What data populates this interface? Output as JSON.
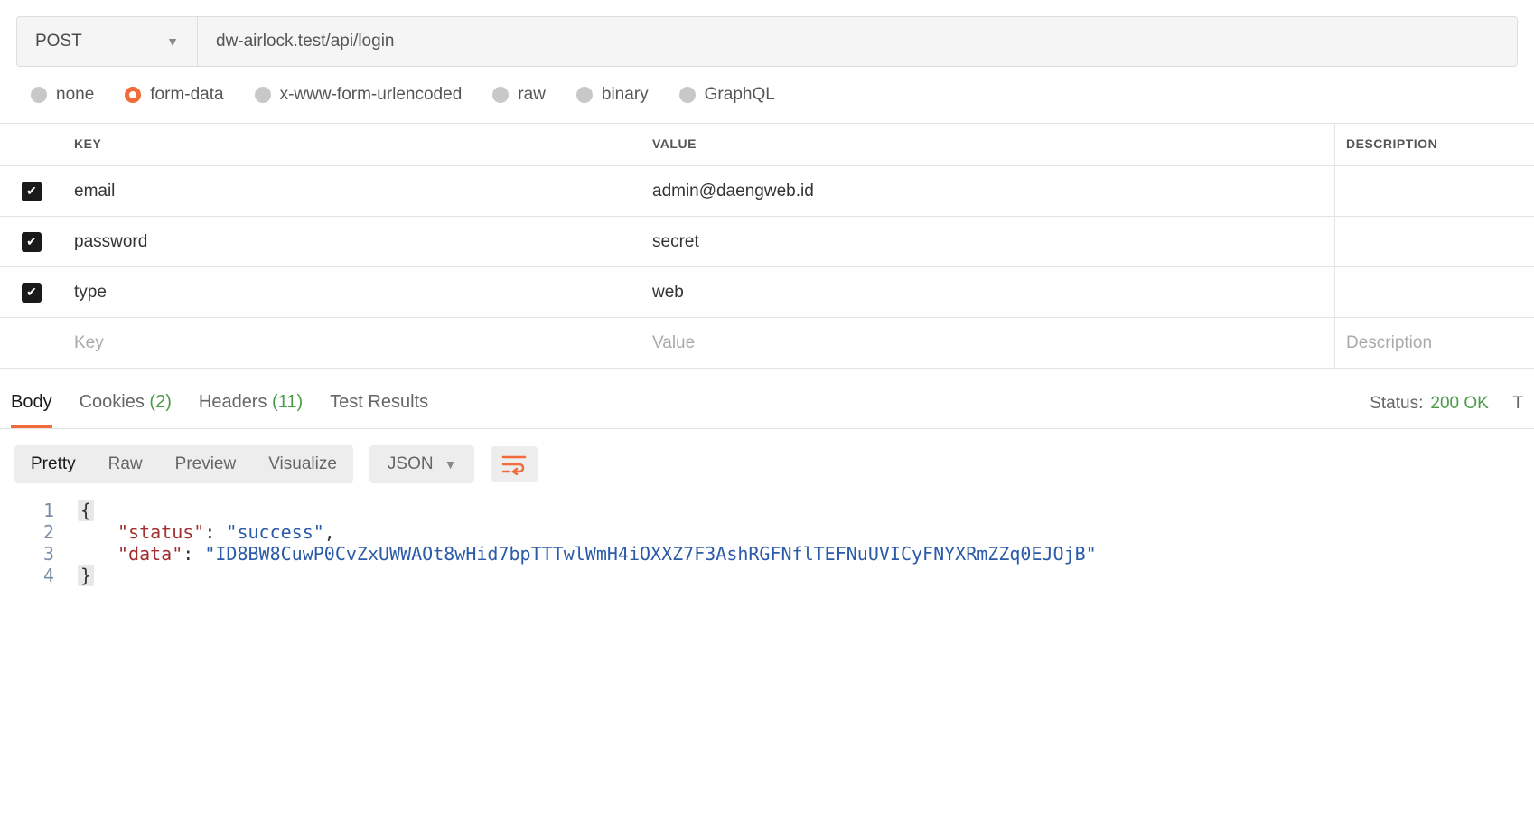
{
  "request": {
    "method": "POST",
    "url": "dw-airlock.test/api/login"
  },
  "body_types": {
    "options": [
      "none",
      "form-data",
      "x-www-form-urlencoded",
      "raw",
      "binary",
      "GraphQL"
    ],
    "selected": "form-data"
  },
  "params_headers": {
    "key": "KEY",
    "value": "VALUE",
    "desc": "DESCRIPTION"
  },
  "params": [
    {
      "checked": true,
      "key": "email",
      "value": "admin@daengweb.id",
      "desc": ""
    },
    {
      "checked": true,
      "key": "password",
      "value": "secret",
      "desc": ""
    },
    {
      "checked": true,
      "key": "type",
      "value": "web",
      "desc": ""
    }
  ],
  "params_placeholder": {
    "key": "Key",
    "value": "Value",
    "desc": "Description"
  },
  "response_tabs": {
    "body": "Body",
    "cookies": {
      "label": "Cookies",
      "count": "(2)"
    },
    "headers": {
      "label": "Headers",
      "count": "(11)"
    },
    "test_results": "Test Results"
  },
  "status": {
    "label": "Status:",
    "code": "200 OK",
    "trail": "T"
  },
  "view_modes": [
    "Pretty",
    "Raw",
    "Preview",
    "Visualize"
  ],
  "format_select": "JSON",
  "response_body": {
    "lines": [
      {
        "n": "1",
        "type": "open"
      },
      {
        "n": "2",
        "type": "kv",
        "key": "\"status\"",
        "val": "\"success\"",
        "trail": ","
      },
      {
        "n": "3",
        "type": "kv",
        "key": "\"data\"",
        "val": "\"ID8BW8CuwP0CvZxUWWAOt8wHid7bpTTTwlWmH4iOXXZ7F3AshRGFNflTEFNuUVICyFNYXRmZZq0EJOjB\"",
        "trail": ""
      },
      {
        "n": "4",
        "type": "close"
      }
    ]
  }
}
